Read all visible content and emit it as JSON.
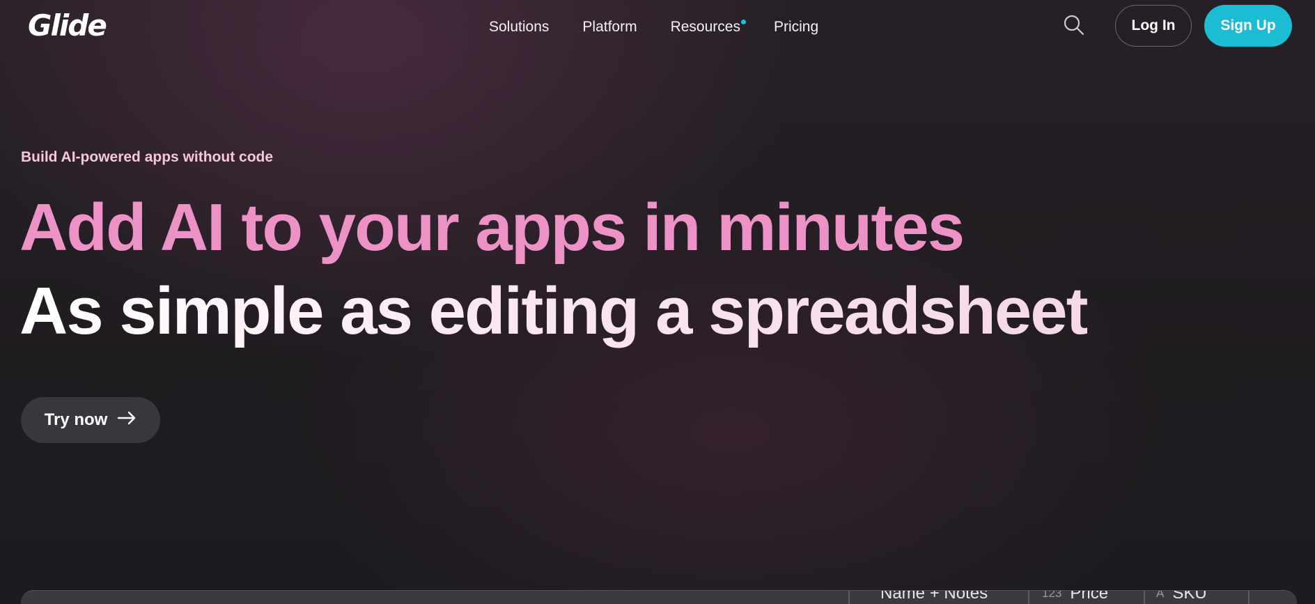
{
  "nav": {
    "logo": "Glide",
    "links": [
      "Solutions",
      "Platform",
      "Resources",
      "Pricing"
    ],
    "login_label": "Log In",
    "signup_label": "Sign Up",
    "accent_color": "#1bbcd4"
  },
  "hero": {
    "eyebrow": "Build AI-powered apps without code",
    "headline_line1": "Add AI to your apps in minutes",
    "headline_line2": "As simple as editing a spreadsheet",
    "cta_label": "Try now",
    "headline_color": "#ec92c6"
  },
  "preview": {
    "columns": [
      {
        "icon": "",
        "label": "Name + Notes"
      },
      {
        "icon": "123",
        "label": "Price"
      },
      {
        "icon": "A",
        "label": "SKU"
      }
    ]
  },
  "icons": {
    "search": "search-icon",
    "arrow": "arrow-right-icon",
    "notification_dot": "notification-dot"
  }
}
